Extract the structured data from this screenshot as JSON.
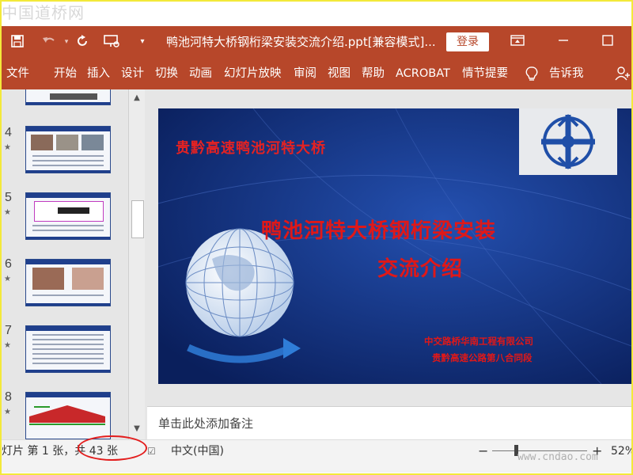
{
  "watermark_top": "中国道桥网",
  "watermark_bottom": "www.cndao.com",
  "titlebar": {
    "doc_title": "鸭池河特大桥钢桁梁安装交流介绍.ppt[兼容模式]...",
    "login_label": "登录"
  },
  "ribbon": {
    "tabs": [
      "文件",
      "开始",
      "插入",
      "设计",
      "切换",
      "动画",
      "幻灯片放映",
      "审阅",
      "视图",
      "帮助",
      "ACROBAT",
      "情节提要",
      "告诉我"
    ]
  },
  "thumbnails": {
    "items": [
      {
        "num": "4"
      },
      {
        "num": "5"
      },
      {
        "num": "6"
      },
      {
        "num": "7"
      },
      {
        "num": "8"
      }
    ]
  },
  "slide": {
    "subtitle": "贵黔高速鸭池河特大桥",
    "title_line1": "鸭池河特大桥钢桁梁安装",
    "title_line2": "交流介绍",
    "org_line1": "中交路桥华南工程有限公司",
    "org_line2": "贵黔高速公路第八合同段"
  },
  "notes": {
    "placeholder": "单击此处添加备注"
  },
  "statusbar": {
    "slide_info": "灯片 第 1 张，共 43 张",
    "language": "中文(中国)",
    "zoom": "52%"
  },
  "colors": {
    "ribbon": "#b7472a",
    "slide_bg": "#0d2d7c",
    "slide_text": "#e01818",
    "highlight_circle": "#e31e1e"
  }
}
